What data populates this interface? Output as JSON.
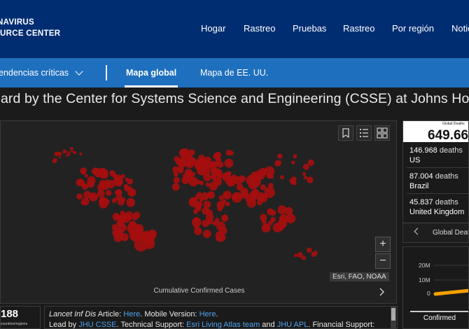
{
  "brand": {
    "line1": "NAVIRUS",
    "line2": "URCE CENTER"
  },
  "nav": {
    "items": [
      "Hogar",
      "Rastreo",
      "Pruebas",
      "Rastreo",
      "Por región",
      "Notic"
    ]
  },
  "subnav": {
    "dropdown": "endencias críticas",
    "global": "Mapa global",
    "us": "Mapa de EE. UU."
  },
  "dashboard": {
    "title": "oard by the Center for Systems Science and Engineering (CSSE) at Johns Ho"
  },
  "map": {
    "attribution": "Esri, FAO, NOAA",
    "caption": "Cumulative Confirmed Cases",
    "zoom_in": "+",
    "zoom_out": "−",
    "marker_color": "#a50e0e"
  },
  "deaths": {
    "label": "Global Deaths",
    "total": "649.66",
    "rows": [
      {
        "num": "146.968",
        "unit": "deaths",
        "country": "US"
      },
      {
        "num": "87.004",
        "unit": "deaths",
        "country": "Brazil"
      },
      {
        "num": "45.837",
        "unit": "deaths",
        "country": "United Kingdom"
      }
    ],
    "footer": "Global Deat"
  },
  "mini_chart": {
    "yticks": [
      "20M",
      "10M",
      "0"
    ],
    "tab": "Confirmed",
    "line_color": "#f5a000"
  },
  "count": {
    "value": "188",
    "label": "countries/regions"
  },
  "info": {
    "line1": {
      "pre": "",
      "journal": "Lancet Inf Dis",
      "mid": " Article: ",
      "link1": "Here",
      "mid2": ". Mobile Version: ",
      "link2": "Here",
      "end": "."
    },
    "line2": {
      "pre": "Lead by ",
      "link1": "JHU CSSE",
      "mid": ". Technical Support: ",
      "link2": "Esri Living Atlas team",
      "mid2": " and ",
      "link3": "JHU APL",
      "end": ". Financial Support:"
    }
  }
}
